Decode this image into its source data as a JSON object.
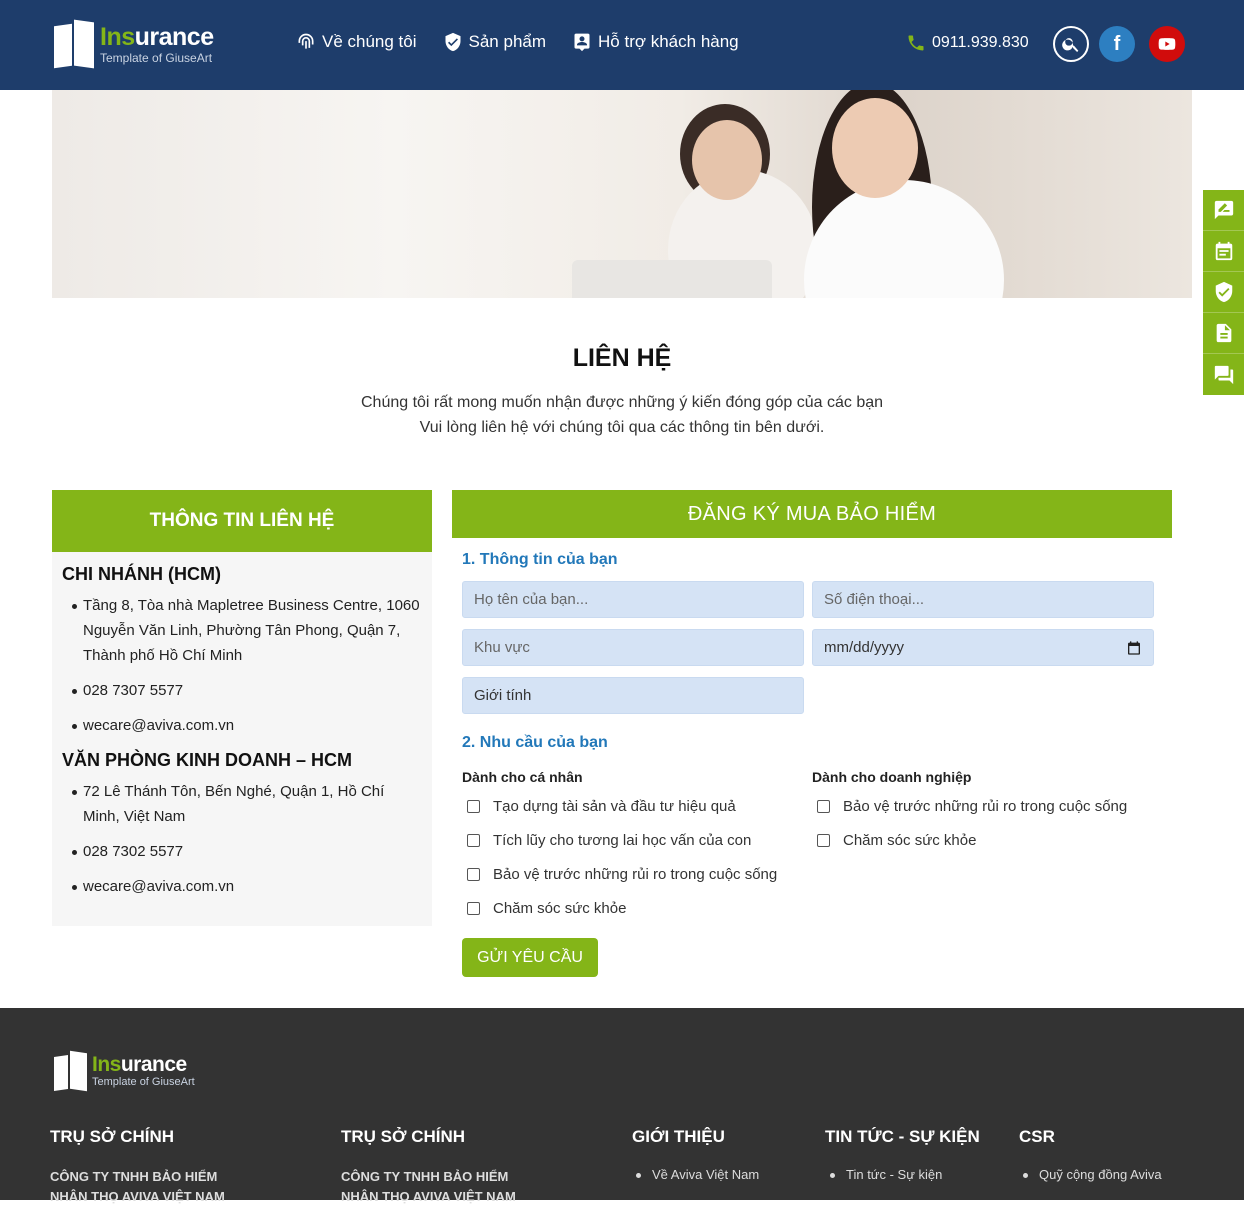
{
  "header": {
    "logo": {
      "name_a": "Ins",
      "name_b": "urance",
      "subtitle": "Template of GiuseArt"
    },
    "nav": [
      {
        "label": "Về chúng tôi",
        "icon": "fingerprint-icon"
      },
      {
        "label": "Sản phẩm",
        "icon": "shield-check-icon"
      },
      {
        "label": "Hỗ trợ khách hàng",
        "icon": "support-icon"
      }
    ],
    "phone": "0911.939.830",
    "facebook_letter": "f"
  },
  "side_tools": [
    "edit-icon",
    "calendar-icon",
    "shield-icon",
    "document-icon",
    "chat-icon"
  ],
  "page": {
    "title": "LIÊN HỆ",
    "intro_1": "Chúng tôi rất mong muốn nhận được những ý kiến đóng góp của các bạn",
    "intro_2": "Vui lòng liên hệ với chúng tôi qua các thông tin bên dưới."
  },
  "contact_info": {
    "heading": "THÔNG TIN LIÊN HỆ",
    "branches": [
      {
        "name": "CHI NHÁNH (HCM)",
        "items": [
          "Tầng 8, Tòa nhà Mapletree Business Centre, 1060 Nguyễn Văn Linh, Phường Tân Phong, Quận 7, Thành phố Hồ Chí Minh",
          "028 7307 5577",
          "wecare@aviva.com.vn"
        ]
      },
      {
        "name": "VĂN PHÒNG KINH DOANH – HCM",
        "items": [
          "72 Lê Thánh Tôn, Bến Nghé, Quận 1, Hồ Chí Minh, Việt Nam",
          "028 7302 5577",
          "wecare@aviva.com.vn"
        ]
      }
    ]
  },
  "form": {
    "heading": "ĐĂNG KÝ MUA BẢO HIỂM",
    "section_1": "1. Thông tin của bạn",
    "fields": {
      "name": "Họ tên của bạn...",
      "phone": "Số điện thoại...",
      "region": "Khu vực",
      "date": "mm/dd/yyyy",
      "gender": "Giới tính"
    },
    "section_2": "2. Nhu cầu của bạn",
    "personal": {
      "heading": "Dành cho cá nhân",
      "options": [
        "Tạo dựng tài sản và đầu tư hiệu quả",
        "Tích lũy cho tương lai học vấn của con",
        "Bảo vệ trước những rủi ro trong cuộc sống",
        "Chăm sóc sức khỏe"
      ]
    },
    "business": {
      "heading": "Dành cho doanh nghiệp",
      "options": [
        "Bảo vệ trước những rủi ro trong cuộc sống",
        "Chăm sóc sức khỏe"
      ]
    },
    "submit": "GỬI YÊU CẦU"
  },
  "footer": {
    "logo": {
      "name_a": "Ins",
      "name_b": "urance",
      "subtitle": "Template of GiuseArt"
    },
    "columns": [
      {
        "title": "TRỤ SỞ CHÍNH",
        "text": "CÔNG TY TNHH BẢO HIỂM",
        "text2": "NHÂN THỌ AVIVA VIỆT NAM"
      },
      {
        "title": "TRỤ SỞ CHÍNH",
        "text": "CÔNG TY TNHH BẢO HIỂM",
        "text2": "NHÂN THỌ AVIVA VIỆT NAM"
      },
      {
        "title": "GIỚI THIỆU",
        "item": "Về Aviva Việt Nam"
      },
      {
        "title": "TIN TỨC - SỰ KIỆN",
        "item": "Tin tức - Sự kiện"
      },
      {
        "title": "CSR",
        "item": "Quỹ cộng đồng Aviva"
      }
    ]
  },
  "colors": {
    "header_bg": "#1e3d6b",
    "accent_green": "#84b518",
    "link_blue": "#2278b9",
    "footer_bg": "#333333"
  }
}
